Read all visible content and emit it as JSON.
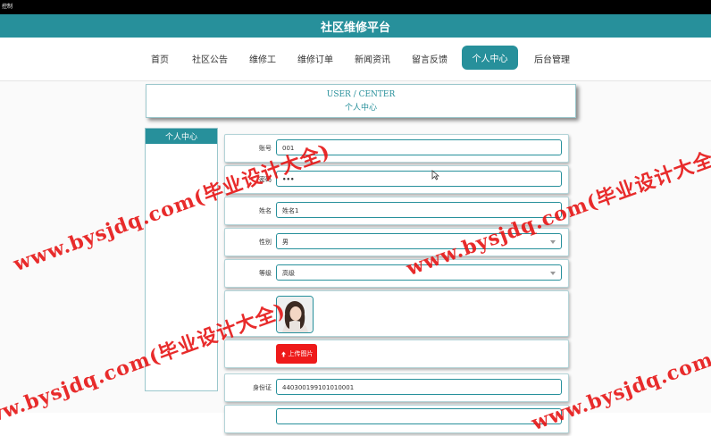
{
  "window": {
    "title_fragment": "控制"
  },
  "header": {
    "title": "社区维修平台"
  },
  "nav": {
    "items": [
      {
        "label": "首页"
      },
      {
        "label": "社区公告"
      },
      {
        "label": "维修工"
      },
      {
        "label": "维修订单"
      },
      {
        "label": "新闻资讯"
      },
      {
        "label": "留言反馈"
      },
      {
        "label": "个人中心",
        "active": true
      },
      {
        "label": "后台管理"
      }
    ]
  },
  "page_title": {
    "en": "USER / CENTER",
    "cn": "个人中心"
  },
  "sidebar": {
    "title": "个人中心"
  },
  "form": {
    "account": {
      "label": "账号",
      "value": "001"
    },
    "password": {
      "label": "密码",
      "value": "•••"
    },
    "name": {
      "label": "姓名",
      "value": "姓名1"
    },
    "gender": {
      "label": "性别",
      "value": "男"
    },
    "level": {
      "label": "等级",
      "value": "高级"
    },
    "upload": {
      "label": "上传图片"
    },
    "id_card": {
      "label": "身份证",
      "value": "440300199101010001"
    }
  },
  "watermark": {
    "text": "www.bysjdq.com(毕业设计大全)"
  },
  "colors": {
    "accent": "#27909b",
    "upload": "#ee1a1a",
    "watermark": "#e61414"
  }
}
